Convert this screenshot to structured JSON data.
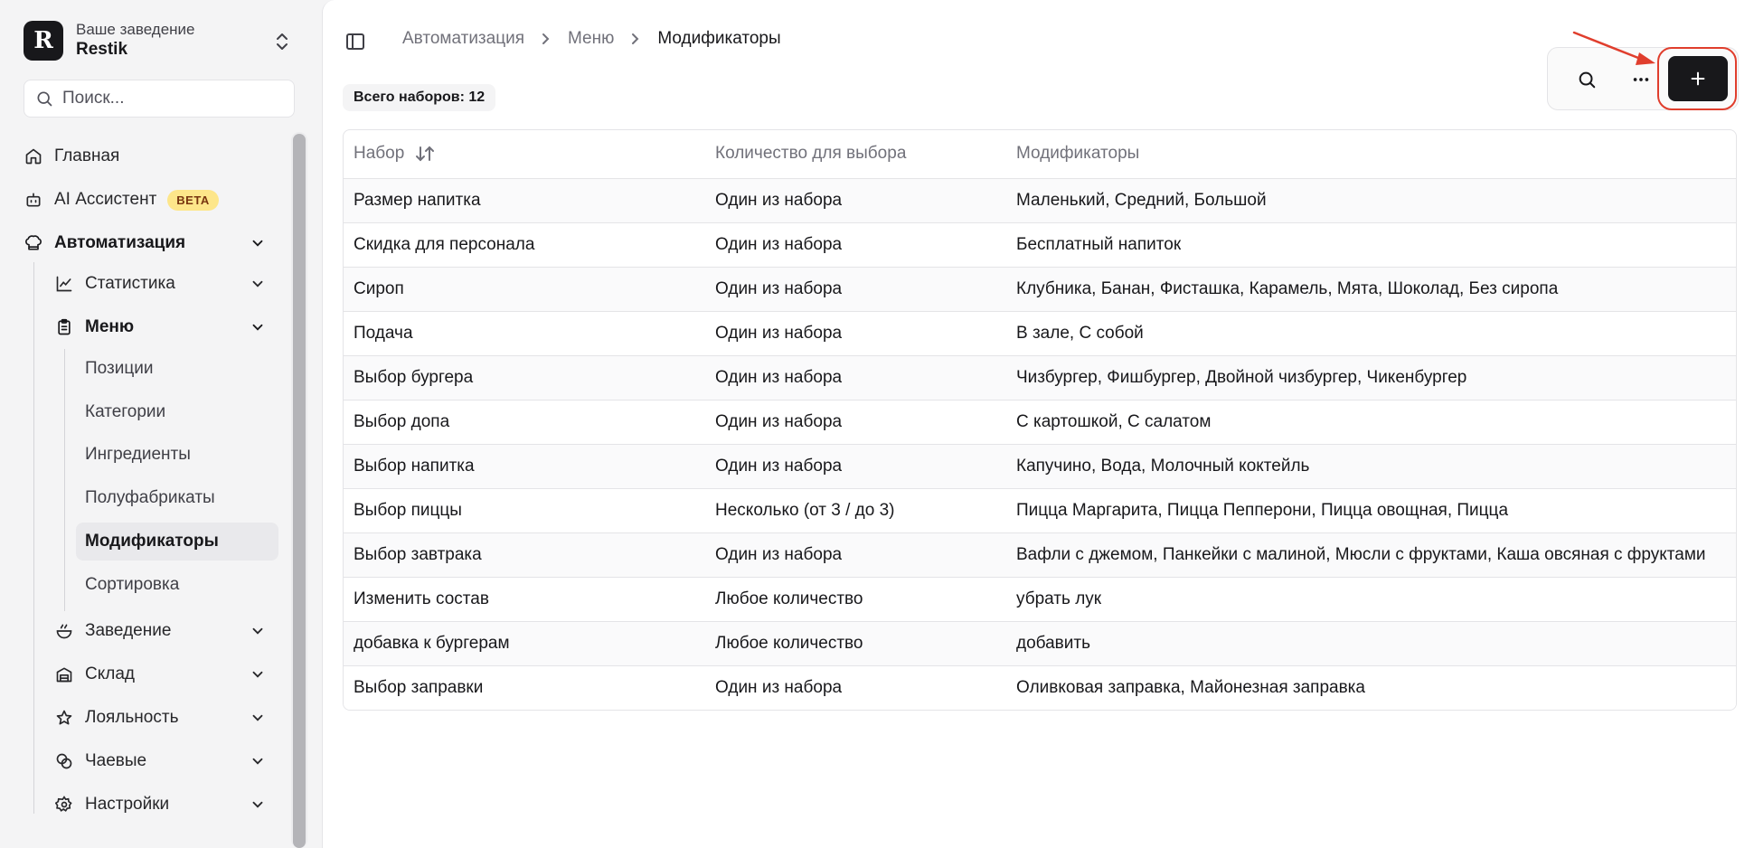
{
  "brand": {
    "logo_letter": "R",
    "subtitle": "Ваше заведение",
    "name": "Restik"
  },
  "search": {
    "placeholder": "Поиск..."
  },
  "nav": {
    "home": "Главная",
    "ai": "AI Ассистент",
    "ai_badge": "BETA",
    "automation": "Автоматизация",
    "statistics": "Статистика",
    "menu": "Меню",
    "menu_items": [
      "Позиции",
      "Категории",
      "Ингредиенты",
      "Полуфабрикаты",
      "Модификаторы",
      "Сортировка"
    ],
    "venue": "Заведение",
    "warehouse": "Склад",
    "loyalty": "Лояльность",
    "tips": "Чаевые",
    "settings": "Настройки"
  },
  "breadcrumb": [
    "Автоматизация",
    "Меню",
    "Модификаторы"
  ],
  "count_label": "Всего наборов: 12",
  "table": {
    "headers": [
      "Набор",
      "Количество для выбора",
      "Модификаторы"
    ],
    "rows": [
      [
        "Размер напитка",
        "Один из набора",
        "Маленький, Средний, Большой"
      ],
      [
        "Скидка для персонала",
        "Один из набора",
        "Бесплатный напиток"
      ],
      [
        "Сироп",
        "Один из набора",
        "Клубника, Банан, Фисташка, Карамель, Мята, Шоколад, Без сиропа"
      ],
      [
        "Подача",
        "Один из набора",
        "В зале, С собой"
      ],
      [
        "Выбор бургера",
        "Один из набора",
        "Чизбургер, Фишбургер, Двойной чизбургер, Чикенбургер"
      ],
      [
        "Выбор допа",
        "Один из набора",
        "С картошкой, С салатом"
      ],
      [
        "Выбор напитка",
        "Один из набора",
        "Капучино, Вода, Молочный коктейль"
      ],
      [
        "Выбор пиццы",
        "Несколько (от 3 / до 3)",
        "Пицца Маргарита, Пицца Пепперони, Пицца овощная, Пицца"
      ],
      [
        "Выбор завтрака",
        "Один из набора",
        "Вафли с джемом, Панкейки с малиной, Мюсли с фруктами, Каша овсяная с фруктами"
      ],
      [
        "Изменить состав",
        "Любое количество",
        "убрать лук"
      ],
      [
        "добавка к бургерам",
        "Любое количество",
        "добавить"
      ],
      [
        "Выбор заправки",
        "Один из набора",
        "Оливковая заправка, Майонезная заправка"
      ]
    ]
  },
  "colors": {
    "accent": "#18181b",
    "highlight": "#e03e2d",
    "badge_beta": "#fde68a"
  }
}
